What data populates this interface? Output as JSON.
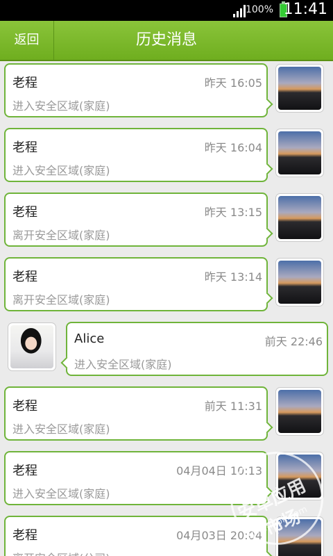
{
  "status_bar": {
    "battery_percent": "100%",
    "time": "11:41",
    "icons": [
      "signal-icon",
      "battery-icon"
    ]
  },
  "header": {
    "back_label": "返回",
    "title": "历史消息"
  },
  "messages": [
    {
      "sender": "老程",
      "time": "昨天 16:05",
      "text": "进入安全区域(家庭)",
      "side": "left"
    },
    {
      "sender": "老程",
      "time": "昨天 16:04",
      "text": "进入安全区域(家庭)",
      "side": "left"
    },
    {
      "sender": "老程",
      "time": "昨天 13:15",
      "text": "离开安全区域(家庭)",
      "side": "left"
    },
    {
      "sender": "老程",
      "time": "昨天 13:14",
      "text": "离开安全区域(家庭)",
      "side": "left"
    },
    {
      "sender": "Alice",
      "time": "前天 22:46",
      "text": "进入安全区域(家庭)",
      "side": "right"
    },
    {
      "sender": "老程",
      "time": "前天 11:31",
      "text": "进入安全区域(家庭)",
      "side": "left"
    },
    {
      "sender": "老程",
      "time": "04月04日 10:13",
      "text": "进入安全区域(家庭)",
      "side": "left"
    },
    {
      "sender": "老程",
      "time": "04月03日 20:04",
      "text": "离开安全区域(公司)",
      "side": "left"
    }
  ],
  "watermark": {
    "text": "安卓应用市场",
    "sub": "apk.hiapk.com"
  },
  "colors": {
    "accent": "#6fb43a",
    "header": "#7bb92b"
  }
}
